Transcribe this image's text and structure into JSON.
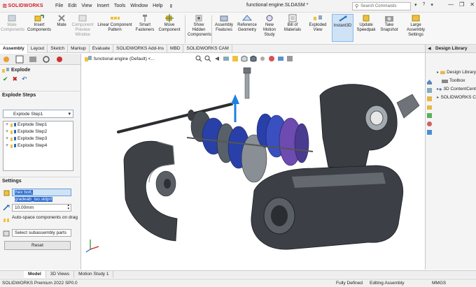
{
  "app": {
    "brand": "SOLIDWORKS",
    "document_title": "functional engine.SLDASM *",
    "search_placeholder": "Search Commands"
  },
  "menu": [
    "File",
    "Edit",
    "View",
    "Insert",
    "Tools",
    "Window",
    "Help"
  ],
  "commands": [
    {
      "l1": "Mate",
      "l2": "Components",
      "pre": "Mate",
      "disabled": true
    },
    {
      "l1": "Insert",
      "l2": "Components"
    },
    {
      "l1": "Mate",
      "l2": ""
    },
    {
      "l1": "Component",
      "l2": "Preview",
      "l3": "Window",
      "disabled": true
    },
    {
      "l1": "Linear Component",
      "l2": "Pattern"
    },
    {
      "l1": "Smart",
      "l2": "Fasteners"
    },
    {
      "l1": "Move",
      "l2": "Component"
    },
    {
      "l1": "Show",
      "l2": "Hidden",
      "l3": "Components"
    },
    {
      "l1": "Assembly",
      "l2": "Features"
    },
    {
      "l1": "Reference",
      "l2": "Geometry"
    },
    {
      "l1": "New",
      "l2": "Motion",
      "l3": "Study"
    },
    {
      "l1": "Bill of",
      "l2": "Materials"
    },
    {
      "l1": "Exploded",
      "l2": "View"
    },
    {
      "l1": "Instant3D",
      "l2": ""
    },
    {
      "l1": "Update",
      "l2": "Speedpak"
    },
    {
      "l1": "Take",
      "l2": "Snapshot"
    },
    {
      "l1": "Large Assembly",
      "l2": "Settings"
    }
  ],
  "tabs": [
    "Assembly",
    "Layout",
    "Sketch",
    "Markup",
    "Evaluate",
    "SOLIDWORKS Add-Ins",
    "MBD",
    "SOLIDWORKS CAM"
  ],
  "property_manager": {
    "title": "Explode",
    "steps_section": "Explode Steps",
    "steps_combo": "Explode Step1",
    "steps": [
      "Explode Step1",
      "Explode Step2",
      "Explode Step3",
      "Explode Step4"
    ],
    "settings_section": "Settings",
    "selected_part": "hex bolt, gradeab_iso.sldprt",
    "distance": "10.00mm",
    "auto_space": "Auto-space components on drag",
    "subassembly": "Select subassembly parts",
    "reset": "Reset"
  },
  "graphics": {
    "tree_label": "functional engine (Default) <..."
  },
  "design_library": {
    "title": "Design Library",
    "items": [
      "Design Library",
      "Toolbox",
      "3D ContentCent",
      "SOLIDWORKS C"
    ]
  },
  "bottom_tabs": [
    "Model",
    "3D Views",
    "Motion Study 1"
  ],
  "status": {
    "version": "SOLIDWORKS Premium 2022 SP0.0",
    "defined": "Fully Defined",
    "editing": "Editing Assembly",
    "units": "MMGS"
  },
  "colors": {
    "brand_red": "#d02027",
    "part_blue": "#2840a8",
    "metal_dark": "#3a3d42",
    "arrow_blue": "#1e7fe0"
  }
}
